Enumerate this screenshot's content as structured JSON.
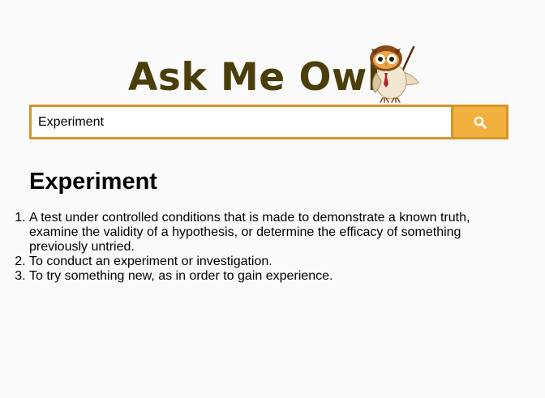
{
  "logo": {
    "text": "Ask Me Owl",
    "owl_icon": "owl-teacher-icon"
  },
  "search": {
    "value": "Experiment",
    "button_icon": "search-icon"
  },
  "result": {
    "title": "Experiment",
    "definitions": [
      "A test under controlled conditions that is made to demonstrate a known truth, examine the validity of a hypothesis, or determine the efficacy of something previously untried.",
      "To conduct an experiment or investigation.",
      "To try something new, as in order to gain experience."
    ]
  },
  "colors": {
    "accent_border": "#d3952b",
    "button_fill": "#f2b13e",
    "logo_text": "#4a3f0b",
    "background": "#fafafa"
  }
}
